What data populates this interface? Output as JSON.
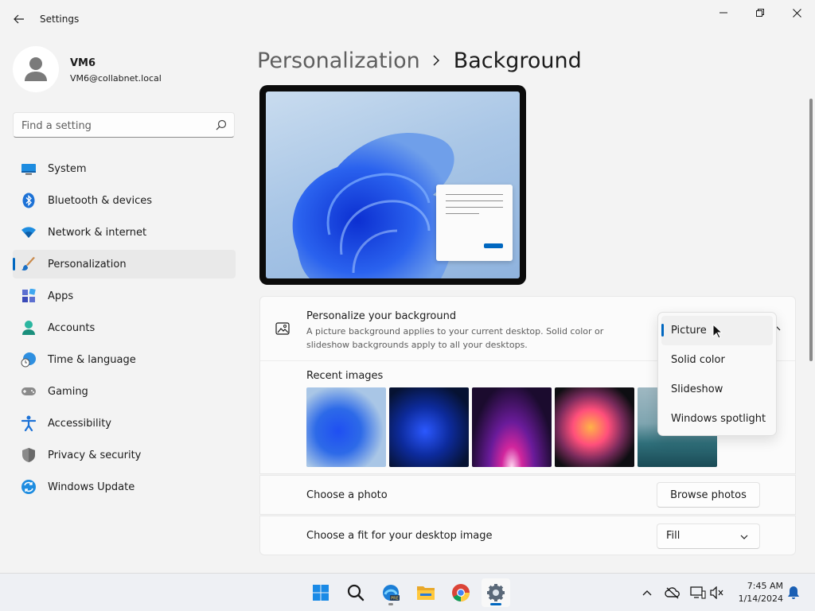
{
  "window": {
    "title": "Settings"
  },
  "user": {
    "name": "VM6",
    "email": "VM6@collabnet.local"
  },
  "search": {
    "placeholder": "Find a setting"
  },
  "sidebar": {
    "items": [
      {
        "label": "System",
        "icon": "monitor-icon"
      },
      {
        "label": "Bluetooth & devices",
        "icon": "bluetooth-icon"
      },
      {
        "label": "Network & internet",
        "icon": "wifi-icon"
      },
      {
        "label": "Personalization",
        "icon": "brush-icon",
        "active": true
      },
      {
        "label": "Apps",
        "icon": "apps-icon"
      },
      {
        "label": "Accounts",
        "icon": "person-icon"
      },
      {
        "label": "Time & language",
        "icon": "clock-globe-icon"
      },
      {
        "label": "Gaming",
        "icon": "gamepad-icon"
      },
      {
        "label": "Accessibility",
        "icon": "accessibility-icon"
      },
      {
        "label": "Privacy & security",
        "icon": "shield-icon"
      },
      {
        "label": "Windows Update",
        "icon": "update-icon"
      }
    ]
  },
  "breadcrumb": {
    "parent": "Personalization",
    "current": "Background"
  },
  "background_card": {
    "title": "Personalize your background",
    "description": "A picture background applies to your current desktop. Solid color or slideshow backgrounds apply to all your desktops.",
    "recent_title": "Recent images"
  },
  "dropdown": {
    "selected": "Picture",
    "options": [
      "Picture",
      "Solid color",
      "Slideshow",
      "Windows spotlight"
    ]
  },
  "photo_row": {
    "label": "Choose a photo",
    "button": "Browse photos"
  },
  "fit_row": {
    "label": "Choose a fit for your desktop image",
    "value": "Fill"
  },
  "taskbar": {
    "time": "7:45 AM",
    "date": "1/14/2024",
    "apps": [
      "windows-start-icon",
      "search-icon",
      "edge-beta-icon",
      "file-explorer-icon",
      "chrome-icon",
      "settings-gear-icon"
    ]
  },
  "colors": {
    "accent": "#0067c0",
    "background": "#f3f3f3",
    "card": "#fbfbfb"
  }
}
